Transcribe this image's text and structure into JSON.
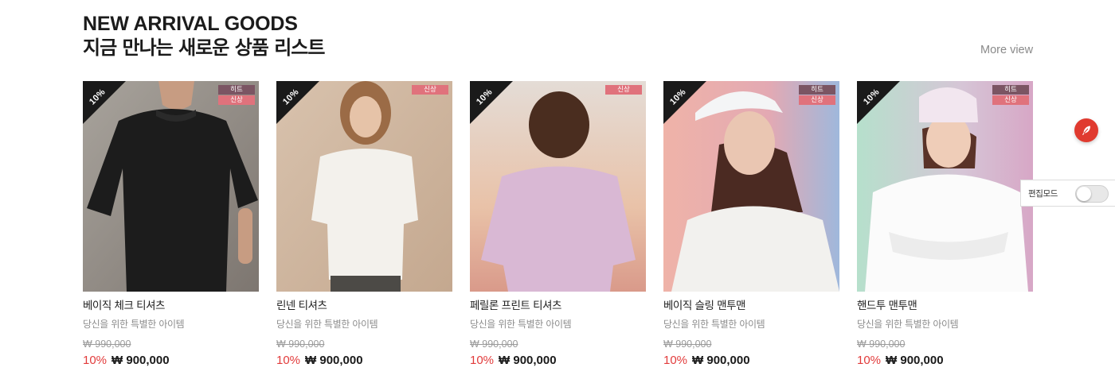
{
  "section": {
    "title_en": "NEW ARRIVAL GOODS",
    "title_ko": "지금 만나는 새로운 상품 리스트",
    "more_view": "More view"
  },
  "products": [
    {
      "name": "베이직 체크 티셔츠",
      "desc": "당신을 위한 특별한 아이템",
      "original_price": "₩ 990,000",
      "discount": "10%",
      "price": "₩ 900,000",
      "corner_label": "10%",
      "badges": [
        "히트",
        "신상"
      ],
      "image": "model in black t-shirt"
    },
    {
      "name": "린넨 티셔츠",
      "desc": "당신을 위한 특별한 아이템",
      "original_price": "₩ 990,000",
      "discount": "10%",
      "price": "₩ 900,000",
      "corner_label": "10%",
      "badges": [
        "신상"
      ],
      "image": "model in white t-shirt"
    },
    {
      "name": "페릴론 프린트 티셔츠",
      "desc": "당신을 위한 특별한 아이템",
      "original_price": "₩ 990,000",
      "discount": "10%",
      "price": "₩ 900,000",
      "corner_label": "10%",
      "badges": [
        "신상"
      ],
      "image": "model back view in lavender t-shirt"
    },
    {
      "name": "베이직 슬링 맨투맨",
      "desc": "당신을 위한 특별한 아이템",
      "original_price": "₩ 990,000",
      "discount": "10%",
      "price": "₩ 900,000",
      "corner_label": "10%",
      "badges": [
        "히트",
        "신상"
      ],
      "image": "model with white cap and sweatshirt"
    },
    {
      "name": "핸드투 맨투맨",
      "desc": "당신을 위한 특별한 아이템",
      "original_price": "₩ 990,000",
      "discount": "10%",
      "price": "₩ 900,000",
      "corner_label": "10%",
      "badges": [
        "히트",
        "신상"
      ],
      "image": "model with beanie and white sweatshirt"
    }
  ],
  "side_tools": {
    "edit_mode_label": "편집모드",
    "edit_mode_on": false,
    "fab_icon": "feather-icon"
  },
  "colors": {
    "discount": "#e23b3b",
    "badge_hit": "#7b5563",
    "badge_new": "#e0727c",
    "fab": "#e03a2f"
  }
}
